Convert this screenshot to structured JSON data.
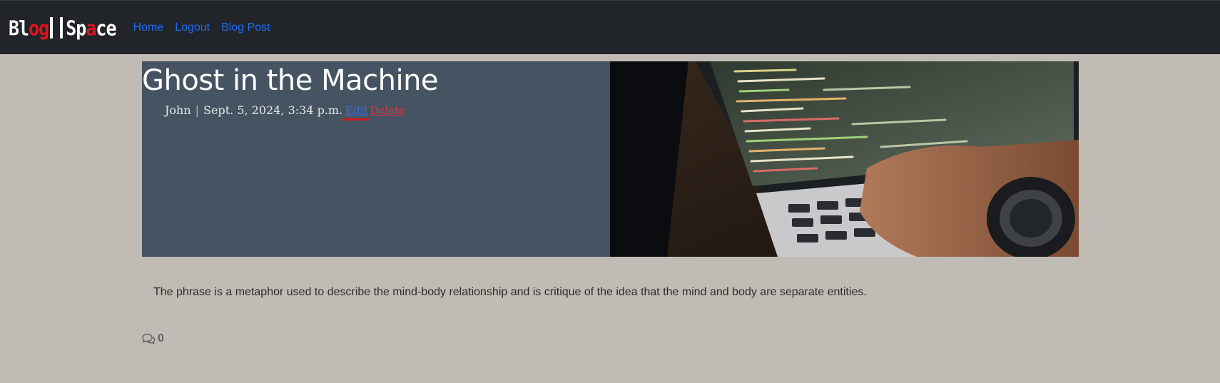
{
  "navbar": {
    "brand": {
      "part1_white": "Bl",
      "part1_red": "og",
      "part2_white": "Sp",
      "part2_red": "a",
      "part2_white2": "ce"
    },
    "links": [
      {
        "label": "Home"
      },
      {
        "label": "Logout"
      },
      {
        "label": "Blog Post"
      }
    ],
    "link_color": "#1e6cf5",
    "background": "#212529"
  },
  "post": {
    "title": "Ghost in the Machine",
    "author": "John",
    "separator": "|",
    "date": "Sept. 5, 2024, 3:34 p.m.",
    "edit_label": "Edit",
    "delete_label": "Delete",
    "body": "The phrase is a metaphor used to describe the mind-body relationship and is critique of the idea that the mind and body are separate entities.",
    "image_alt": "laptop with code on screen and hand typing",
    "comment_icon": "chat-bubbles-icon",
    "comment_count": "0"
  },
  "colors": {
    "page_bg": "#c0bbb4",
    "hero_panel": "#465362",
    "delete": "#dc3545",
    "edit_underline": "#d0181f"
  }
}
